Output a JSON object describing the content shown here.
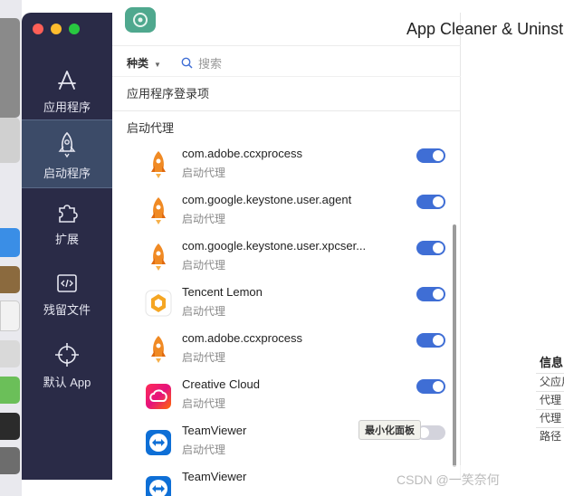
{
  "window_title": "App Cleaner & Uninsta",
  "sidebar": {
    "items": [
      {
        "label": "应用程序",
        "icon": "app-store-icon",
        "active": false
      },
      {
        "label": "启动程序",
        "icon": "rocket-icon",
        "active": true
      },
      {
        "label": "扩展",
        "icon": "puzzle-icon",
        "active": false
      },
      {
        "label": "残留文件",
        "icon": "code-file-icon",
        "active": false
      },
      {
        "label": "默认 App",
        "icon": "crosshair-icon",
        "active": false
      }
    ]
  },
  "toolbar": {
    "category_label": "种类",
    "search_placeholder": "搜索"
  },
  "sections": {
    "login_items": "应用程序登录项",
    "launch_agents": "启动代理"
  },
  "list": [
    {
      "name": "com.adobe.ccxprocess",
      "sub": "启动代理",
      "icon": "rocket-icon",
      "enabled": true
    },
    {
      "name": "com.google.keystone.user.agent",
      "sub": "启动代理",
      "icon": "rocket-icon",
      "enabled": true
    },
    {
      "name": "com.google.keystone.user.xpcser...",
      "sub": "启动代理",
      "icon": "rocket-icon",
      "enabled": true
    },
    {
      "name": "Tencent Lemon",
      "sub": "启动代理",
      "icon": "tencent-lemon-icon",
      "enabled": true
    },
    {
      "name": "com.adobe.ccxprocess",
      "sub": "启动代理",
      "icon": "rocket-icon",
      "enabled": true
    },
    {
      "name": "Creative Cloud",
      "sub": "启动代理",
      "icon": "creative-cloud-icon",
      "enabled": true
    },
    {
      "name": "TeamViewer",
      "sub": "启动代理",
      "icon": "teamviewer-icon",
      "enabled": false
    },
    {
      "name": "TeamViewer",
      "sub": "",
      "icon": "teamviewer-icon",
      "enabled": false
    }
  ],
  "tooltip": "最小化面板",
  "info_panel": {
    "title": "信息",
    "rows": [
      "父应用",
      "代理",
      "代理",
      "路径"
    ]
  },
  "watermark": "CSDN @一笑奈何",
  "colors": {
    "sidebar_bg": "#2a2b47",
    "sidebar_active": "#3c4b68",
    "toggle_on": "#3f6ed5",
    "rocket": "#f08a24"
  }
}
